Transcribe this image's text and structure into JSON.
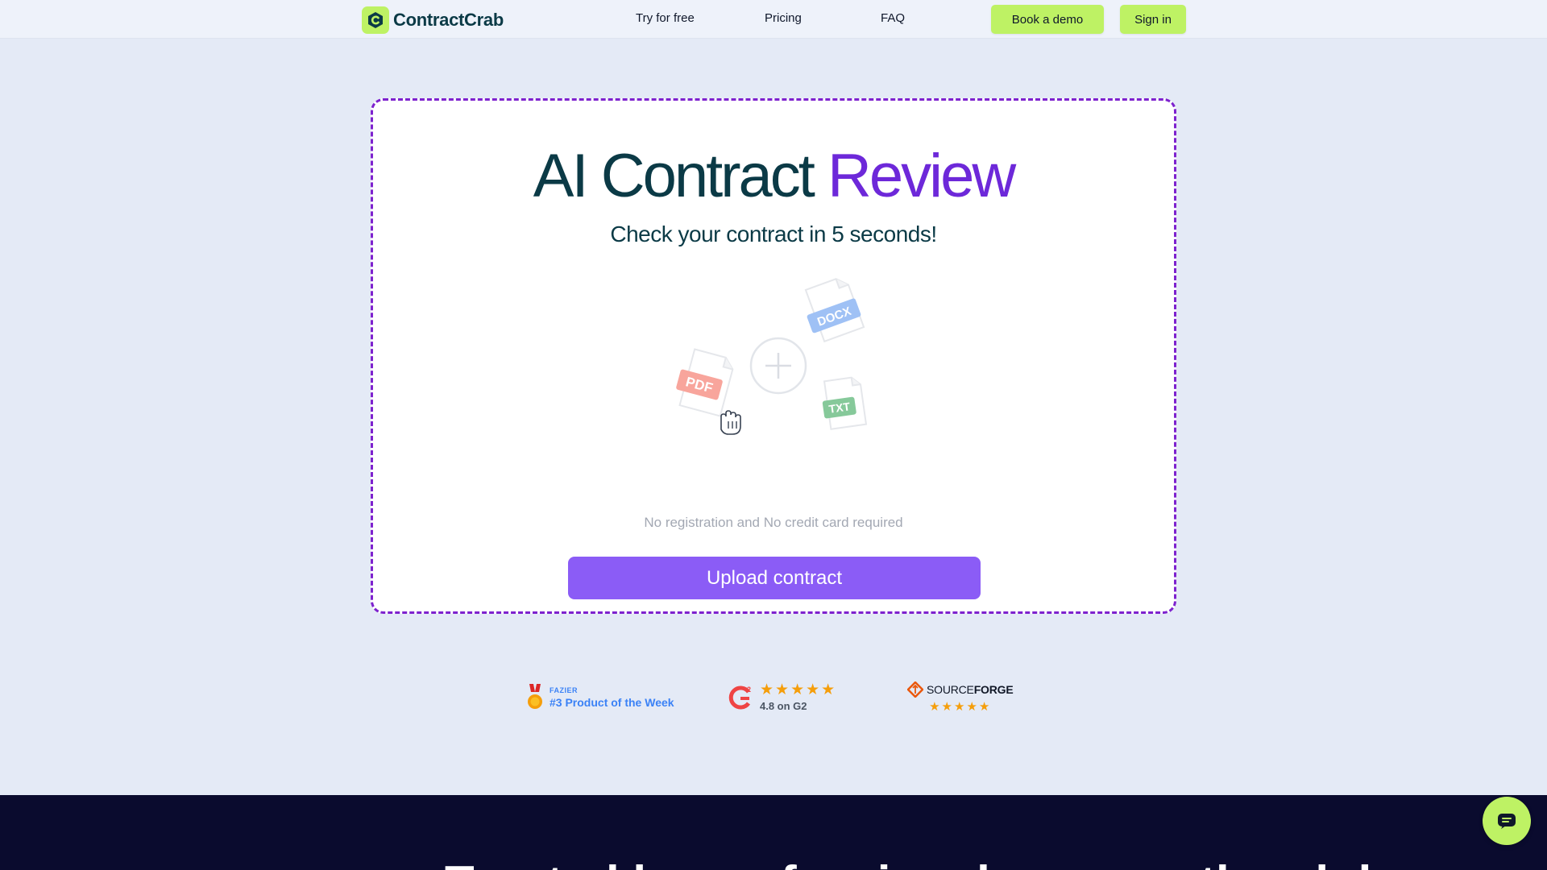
{
  "nav": {
    "brand": "ContractCrab",
    "links": [
      "Try for free",
      "Pricing",
      "FAQ"
    ],
    "book_demo": "Book a demo",
    "sign_in": "Sign in"
  },
  "hero": {
    "title_main": "AI Contract ",
    "title_accent": "Review",
    "subtitle": "Check your contract in 5 seconds!",
    "file_types": [
      "PDF",
      "DOCX",
      "TXT"
    ],
    "note": "No registration and No credit card required",
    "upload_label": "Upload contract"
  },
  "badges": {
    "fazier_small": "FAZIER",
    "fazier_big": "#3 Product of the Week",
    "g2_stars": "★★★★★",
    "g2_rating": "4.8 on G2",
    "sf_source": "SOURCE",
    "sf_forge": "FORGE",
    "sf_stars": "★★★★★"
  },
  "footer": {
    "heading": "Trusted by professionals across the globe"
  },
  "colors": {
    "accent_lime": "#bef264",
    "accent_purple": "#8b5cf6",
    "dashed_border": "#7e22ce",
    "brand_dark": "#0b3a46"
  },
  "icons": [
    "contractcrab-logo-icon",
    "plus-circle-icon",
    "pdf-file-icon",
    "docx-file-icon",
    "txt-file-icon",
    "hand-cursor-icon",
    "medal-icon",
    "g2-logo-icon",
    "sourceforge-logo-icon",
    "chat-icon"
  ]
}
